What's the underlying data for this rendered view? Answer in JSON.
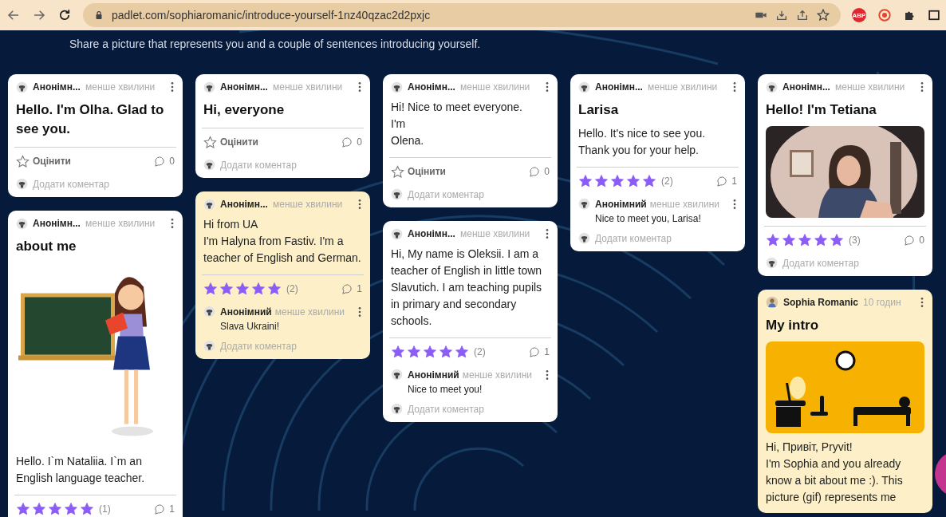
{
  "browser": {
    "url": "padlet.com/sophiaromanic/introduce-yourself-1nz40qzac2d2pxjc",
    "extension_badge": "ABP"
  },
  "header": {
    "subtitle": "Share a picture that represents you and a couple of sentences introducing yourself."
  },
  "columns": [
    {
      "cards": [
        {
          "author": "Анонімн...",
          "time": "менше хвилини",
          "color": "#ffffff",
          "title": "Hello. I'm Olha. Glad to see you.",
          "reaction": {
            "kind": "rate",
            "label": "Оцінити"
          },
          "comment_count": "0",
          "add_comment": "Додати коментар"
        },
        {
          "author": "Анонімн...",
          "time": "менше хвилини",
          "color": "#ffffff",
          "title": "about me",
          "body": "Hello. I`m Nataliia. I`m an English language teacher.",
          "reaction": {
            "kind": "stars",
            "stars": 5,
            "count": "(1)"
          },
          "comment_count": "1"
        }
      ]
    },
    {
      "cards": [
        {
          "author": "Анонімн...",
          "time": "менше хвилини",
          "color": "#ffffff",
          "title": "Hi, everyone",
          "reaction": {
            "kind": "rate",
            "label": "Оцінити"
          },
          "comment_count": "0",
          "add_comment": "Додати коментар"
        },
        {
          "author": "Анонімн...",
          "time": "менше хвилини",
          "color": "#fdf0c8",
          "body": "Hi from UA\nI'm Halyna from Fastiv. I'm a teacher of English and German.",
          "reaction": {
            "kind": "stars",
            "stars": 5,
            "count": "(2)"
          },
          "comment_count": "1",
          "comments": [
            {
              "author": "Анонімний",
              "time": "менше хвилини",
              "text": "Slava Ukraini!"
            }
          ],
          "add_comment": "Додати коментар"
        }
      ]
    },
    {
      "cards": [
        {
          "author": "Анонімн...",
          "time": "менше хвилини",
          "color": "#ffffff",
          "body": "Hi! Nice to meet everyone.\nI'm\nOlena.",
          "reaction": {
            "kind": "rate",
            "label": "Оцінити"
          },
          "comment_count": "0",
          "add_comment": "Додати коментар"
        },
        {
          "author": "Анонімн...",
          "time": "менше хвилини",
          "color": "#ffffff",
          "body": "Hi, My name is Oleksii. I am a teacher of English in little town Slavutich. I am teaching pupils in primary and secondary schools.",
          "reaction": {
            "kind": "stars",
            "stars": 5,
            "count": "(2)"
          },
          "comment_count": "1",
          "comments": [
            {
              "author": "Анонімний",
              "time": "менше хвилини",
              "text": "Nice to meet you!"
            }
          ],
          "add_comment": "Додати коментар"
        }
      ]
    },
    {
      "cards": [
        {
          "author": "Анонімн...",
          "time": "менше хвилини",
          "color": "#ffffff",
          "title": "Larisa",
          "body": "Hello. It's nice to see you.\nThank you for your help.",
          "reaction": {
            "kind": "stars",
            "stars": 5,
            "count": "(2)"
          },
          "comment_count": "1",
          "comments": [
            {
              "author": "Анонімний",
              "time": "менше хвилини",
              "text": "Nice to meet you, Larisa!"
            }
          ],
          "add_comment": "Додати коментар"
        }
      ]
    },
    {
      "cards": [
        {
          "author": "Анонімн...",
          "time": "менше хвилини",
          "color": "#ffffff",
          "title": "Hello! I'm Tetiana",
          "reaction": {
            "kind": "stars",
            "stars": 5,
            "count": "(3)"
          },
          "comment_count": "0",
          "add_comment": "Додати коментар"
        },
        {
          "author": "Sophia Romanic",
          "time": "10 годин",
          "color": "#fdf0c8",
          "title": "My intro",
          "body": "Hi, Привіт, Pryvit!\nI'm Sophia and you already know a bit about me :). This picture (gif) represents me"
        }
      ]
    }
  ]
}
